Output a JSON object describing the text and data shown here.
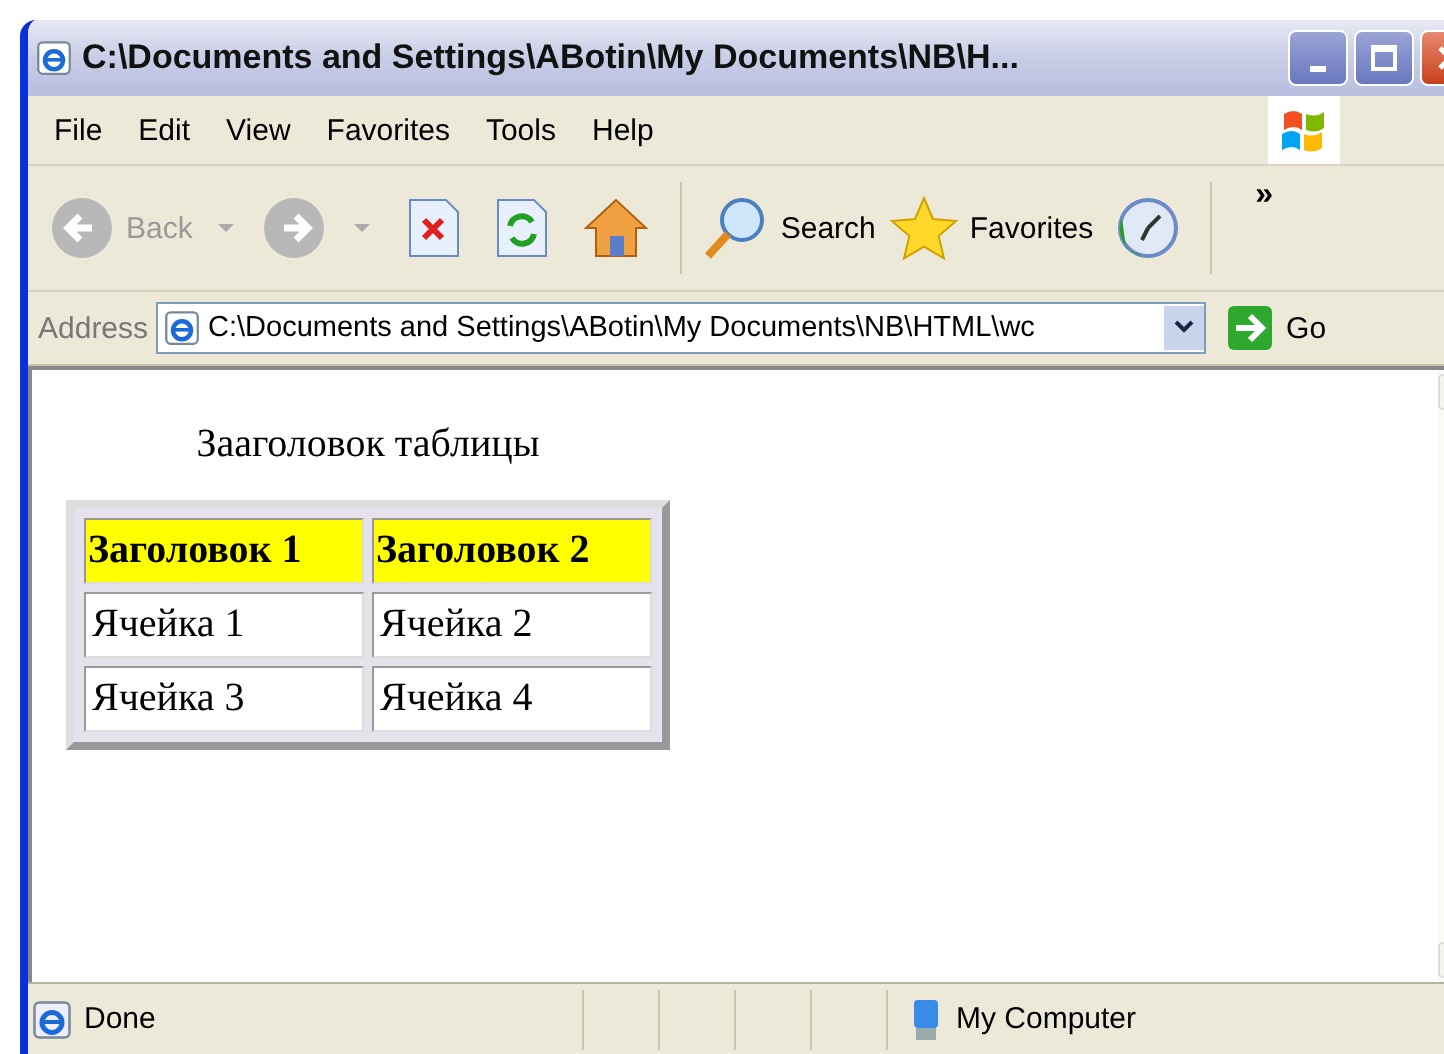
{
  "window": {
    "title": "C:\\Documents and Settings\\ABotin\\My Documents\\NB\\H..."
  },
  "menu": [
    "File",
    "Edit",
    "View",
    "Favorites",
    "Tools",
    "Help"
  ],
  "toolbar": {
    "back": {
      "label": "Back",
      "disabled": true
    },
    "forward": {
      "disabled": true
    },
    "search": "Search",
    "favorites": "Favorites",
    "overflow": "»"
  },
  "address": {
    "label": "Address",
    "value": "C:\\Documents and Settings\\ABotin\\My Documents\\NB\\HTML\\wc",
    "go": "Go"
  },
  "page": {
    "caption": "Зааголовок таблицы",
    "table": {
      "columns": [
        "Заголовок 1",
        "Заголовок 2"
      ],
      "rows": [
        [
          "Ячейка 1",
          "Ячейка 2"
        ],
        [
          "Ячейка 3",
          "Ячейка 4"
        ]
      ]
    }
  },
  "status_bar": {
    "text": "Done",
    "zone": "My Computer"
  }
}
